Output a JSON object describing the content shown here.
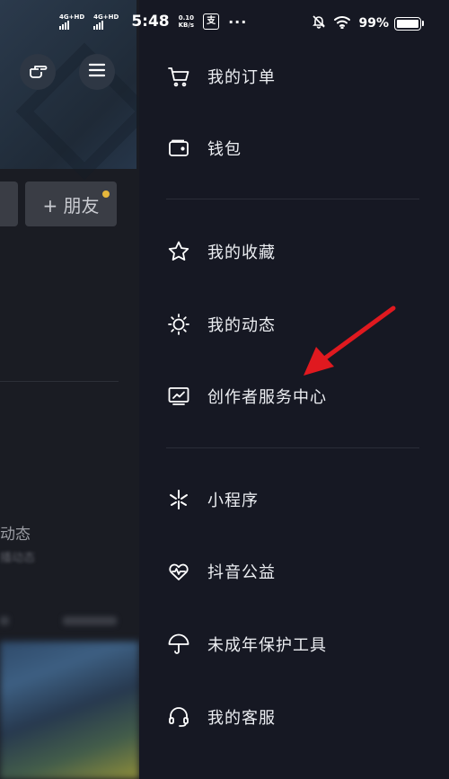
{
  "status_bar": {
    "signal1_label": "4G+HD",
    "signal2_label": "4G+HD",
    "time": "5:48",
    "speed_value": "0.10",
    "speed_unit": "KB/s",
    "app_icon_glyph": "支",
    "more": "···",
    "battery": "99%"
  },
  "background_page": {
    "friend_button": "+ 朋友",
    "dynamic_text": "动态",
    "dynamic_sub": "播动态"
  },
  "drawer": {
    "group1": [
      {
        "icon": "cart-icon",
        "label": "我的订单"
      },
      {
        "icon": "wallet-icon",
        "label": "钱包"
      }
    ],
    "group2": [
      {
        "icon": "star-icon",
        "label": "我的收藏"
      },
      {
        "icon": "sun-icon",
        "label": "我的动态"
      },
      {
        "icon": "chart-monitor-icon",
        "label": "创作者服务中心"
      }
    ],
    "group3": [
      {
        "icon": "mini-program-icon",
        "label": "小程序"
      },
      {
        "icon": "heart-icon",
        "label": "抖音公益"
      },
      {
        "icon": "umbrella-icon",
        "label": "未成年保护工具"
      },
      {
        "icon": "headset-icon",
        "label": "我的客服"
      }
    ]
  },
  "colors": {
    "drawer_bg": "#161823",
    "accent_arrow": "#e0191f",
    "notification_dot": "#e6b73c"
  }
}
